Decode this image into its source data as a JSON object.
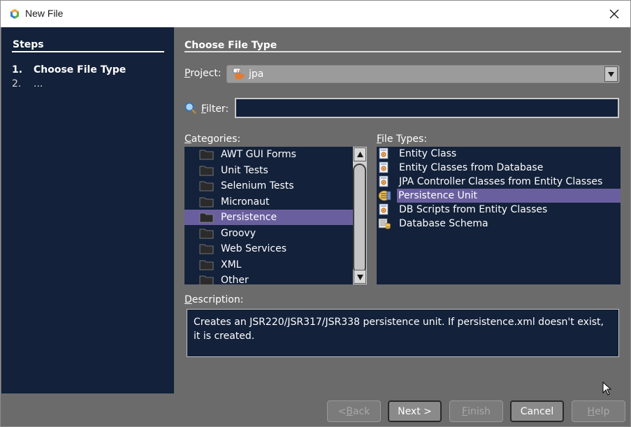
{
  "window": {
    "title": "New File"
  },
  "steps": {
    "header": "Steps",
    "items": [
      {
        "num": "1.",
        "label": "Choose File Type"
      },
      {
        "num": "2.",
        "label": "..."
      }
    ]
  },
  "main": {
    "title": "Choose File Type",
    "project_label_mnemonic": "P",
    "project_label_rest": "roject:",
    "project_value": "jpa",
    "filter_label_mnemonic": "F",
    "filter_label_rest": "ilter:",
    "filter_value": "",
    "categories_label_mnemonic": "C",
    "categories_label_rest": "ategories:",
    "filetypes_label_mnemonic": "F",
    "filetypes_label_rest": "ile Types:",
    "description_label_mnemonic": "D",
    "description_label_rest": "escription:",
    "description_text": "Creates an JSR220/JSR317/JSR338 persistence unit. If persistence.xml doesn't exist, it is created."
  },
  "categories": [
    {
      "label": "AWT GUI Forms"
    },
    {
      "label": "Unit Tests"
    },
    {
      "label": "Selenium Tests"
    },
    {
      "label": "Micronaut"
    },
    {
      "label": "Persistence"
    },
    {
      "label": "Groovy"
    },
    {
      "label": "Web Services"
    },
    {
      "label": "XML"
    },
    {
      "label": "Other"
    }
  ],
  "file_types": [
    {
      "label": "Entity Class",
      "icon": "entity-class-icon"
    },
    {
      "label": "Entity Classes from Database",
      "icon": "entity-class-icon"
    },
    {
      "label": "JPA Controller Classes from Entity Classes",
      "icon": "entity-class-icon"
    },
    {
      "label": "Persistence Unit",
      "icon": "persistence-unit-icon"
    },
    {
      "label": "DB Scripts from Entity Classes",
      "icon": "entity-class-icon"
    },
    {
      "label": "Database Schema",
      "icon": "database-schema-icon"
    }
  ],
  "buttons": {
    "back_prefix": "< ",
    "back_mnemonic": "B",
    "back_rest": "ack",
    "next": "Next >",
    "finish_mnemonic": "F",
    "finish_rest": "inish",
    "cancel": "Cancel",
    "help_mnemonic": "H",
    "help_rest": "elp"
  },
  "colors": {
    "panel_bg": "#13213a",
    "dialog_bg": "#6b6b6b",
    "selection": "#6a5f9e"
  }
}
